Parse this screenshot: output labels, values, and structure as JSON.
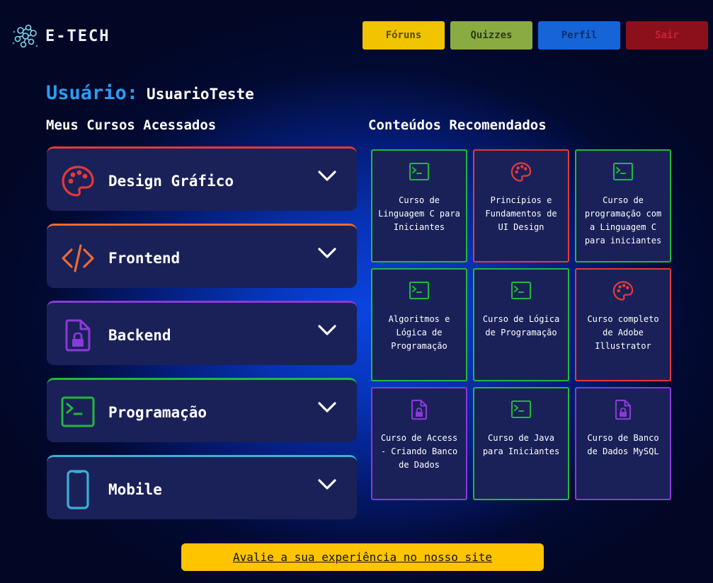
{
  "header": {
    "logo_text": "E-TECH",
    "nav": [
      {
        "label": "Fóruns",
        "bg": "#f0c400",
        "color": "#5a4a00"
      },
      {
        "label": "Quizzes",
        "bg": "#8aab42",
        "color": "#2e3b14"
      },
      {
        "label": "Perfil",
        "bg": "#1565d8",
        "color": "#0a2f70"
      },
      {
        "label": "Sair",
        "bg": "#8c0f1c",
        "color": "#c42436"
      }
    ]
  },
  "user": {
    "label": "Usuário:",
    "name": "UsuarioTeste"
  },
  "courses": {
    "title": "Meus Cursos Acessados",
    "items": [
      {
        "label": "Design Gráfico",
        "icon": "palette-icon",
        "color": "#e33a3a"
      },
      {
        "label": "Frontend",
        "icon": "code-icon",
        "color": "#ec6b35"
      },
      {
        "label": "Backend",
        "icon": "locked-file-icon",
        "color": "#8a3ad8"
      },
      {
        "label": "Programação",
        "icon": "terminal-icon",
        "color": "#22b83c"
      },
      {
        "label": "Mobile",
        "icon": "smartphone-icon",
        "color": "#3ab0d8"
      }
    ]
  },
  "recommended": {
    "title": "Conteúdos Recomendados",
    "items": [
      {
        "text": "Curso de Linguagem C para Iniciantes",
        "icon": "terminal-icon",
        "color": "#22b83c"
      },
      {
        "text": "Princípios e Fundamentos de UI Design",
        "icon": "palette-icon",
        "color": "#e33a3a"
      },
      {
        "text": "Curso de programação com a Linguagem C para iniciantes",
        "icon": "terminal-icon",
        "color": "#22b83c"
      },
      {
        "text": "Algoritmos e Lógica de Programação",
        "icon": "terminal-icon",
        "color": "#22b83c"
      },
      {
        "text": "Curso de Lógica de Programação",
        "icon": "terminal-icon",
        "color": "#22b83c"
      },
      {
        "text": "Curso completo de Adobe Illustrator",
        "icon": "palette-icon",
        "color": "#e33a3a"
      },
      {
        "text": "Curso de Access - Criando Banco de Dados",
        "icon": "locked-file-icon",
        "color": "#8a3ad8"
      },
      {
        "text": "Curso de Java para Iniciantes",
        "icon": "terminal-icon",
        "color": "#22b83c"
      },
      {
        "text": "Curso de Banco de Dados MySQL",
        "icon": "locked-file-icon",
        "color": "#8a3ad8"
      }
    ]
  },
  "cta": {
    "label": "Avalie a sua experiência no nosso site"
  }
}
